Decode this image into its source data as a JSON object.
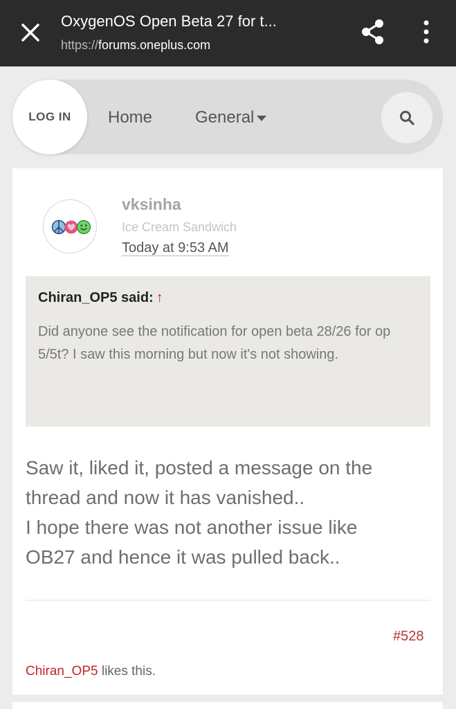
{
  "browser": {
    "title": "OxygenOS Open Beta 27 for t...",
    "url_scheme": "https://",
    "url_host": "forums.oneplus.com",
    "icons": [
      "close-icon",
      "share-icon",
      "more-vert-icon"
    ]
  },
  "nav": {
    "login_label": "LOG IN",
    "home_label": "Home",
    "general_label": "General",
    "icons": [
      "chevron-down-icon",
      "search-icon"
    ]
  },
  "post": {
    "username": "vksinha",
    "user_title": "Ice Cream Sandwich",
    "timestamp": "Today at 9:53 AM",
    "avatar_icons": [
      "peace-icon",
      "heart-icon",
      "smiley-icon"
    ],
    "quote": {
      "author_said": "Chiran_OP5 said:",
      "arrow": "↑",
      "body": "Did anyone see the notification for open beta 28/26 for op 5/5t? I saw this morning but now it's not showing."
    },
    "message_lines": [
      "Saw it, liked it, posted a message on the",
      "thread and now it has vanished..",
      "I hope there was not another issue like",
      "OB27 and hence it was pulled back.."
    ],
    "post_number": "#528",
    "liked_by": "Chiran_OP5",
    "likes_suffix": " likes this.",
    "colors": {
      "accent_red": "#c0282b",
      "quote_bg": "#ebe9e6",
      "topbar_bg": "#2b2b2b"
    }
  }
}
